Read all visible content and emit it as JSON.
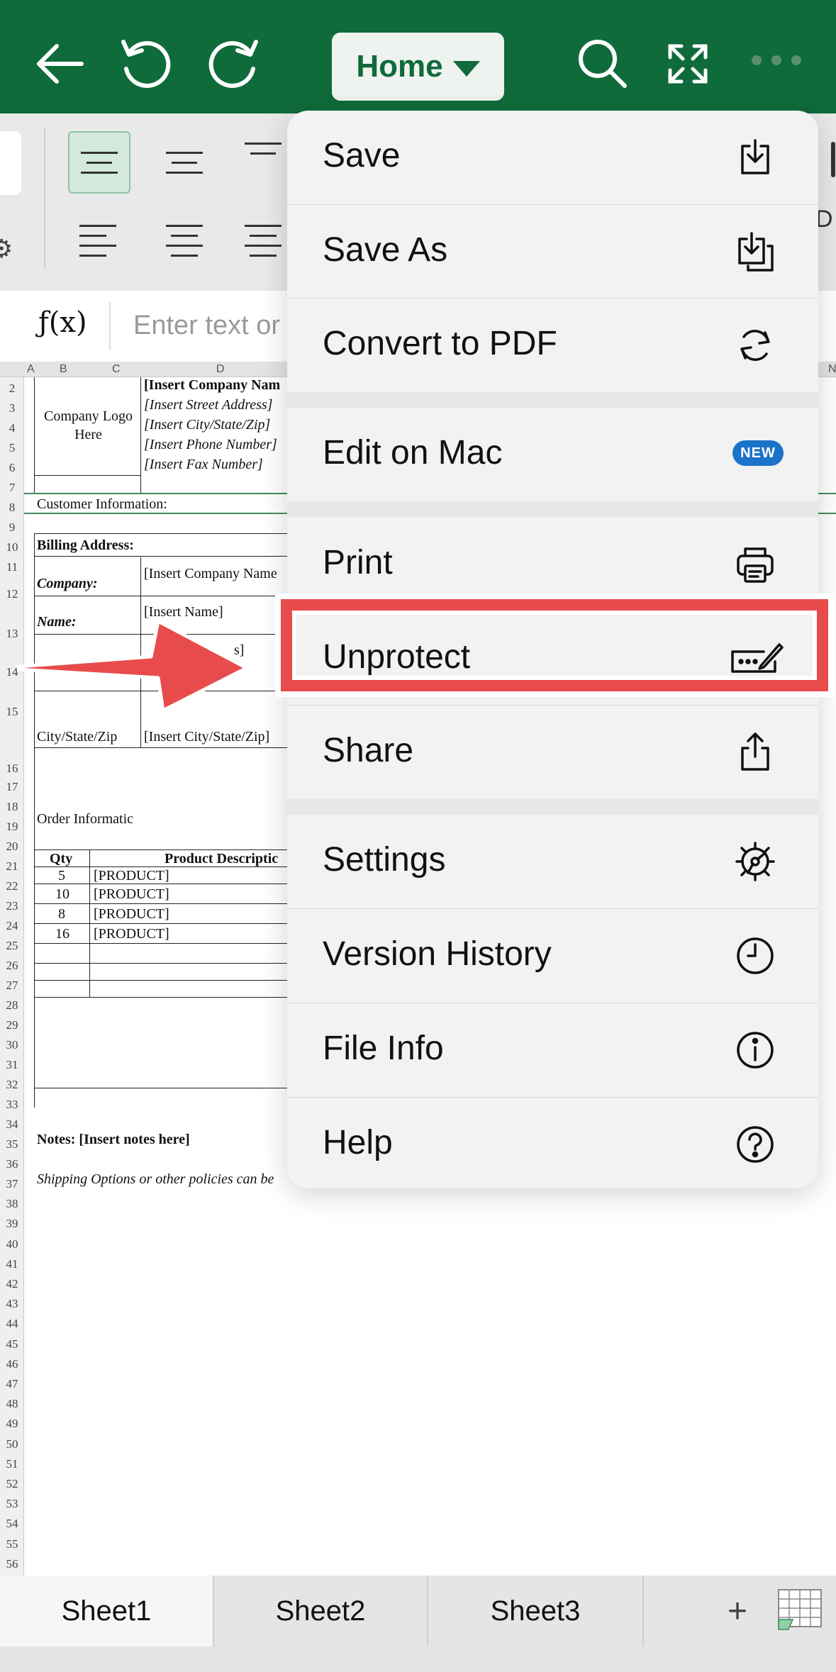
{
  "toolbar": {
    "home_label": "Home",
    "icons": [
      "back-icon",
      "undo-icon",
      "redo-icon",
      "search-icon",
      "fullscreen-icon",
      "more-icon"
    ]
  },
  "ribbon": {
    "partial_letter": "D"
  },
  "formula_bar": {
    "fx_label": "ƒ(x)",
    "placeholder": "Enter text or"
  },
  "sheet": {
    "column_headers": [
      "A",
      "B",
      "C",
      "D",
      "N"
    ],
    "row_numbers": [
      "2",
      "3",
      "4",
      "5",
      "6",
      "7",
      "8",
      "9",
      "10",
      "11",
      "12",
      "13",
      "14",
      "15",
      "16",
      "17",
      "18",
      "19",
      "20",
      "21",
      "22",
      "23",
      "24",
      "25",
      "26",
      "27",
      "28",
      "29",
      "30",
      "31",
      "32",
      "33",
      "34",
      "35",
      "36",
      "37",
      "38",
      "39",
      "40",
      "41",
      "42",
      "43",
      "44",
      "45",
      "46",
      "47",
      "48",
      "49",
      "50",
      "51",
      "52",
      "53",
      "54",
      "55",
      "56"
    ],
    "company_logo": "Company Logo Here",
    "company_lines": [
      "[Insert Company Nam",
      "[Insert Street Address]",
      "[Insert City/State/Zip]",
      "[Insert Phone Number]",
      "[Insert Fax Number]"
    ],
    "customer_info": "Customer Information:",
    "billing_address": "Billing Address:",
    "company_label": "Company:",
    "company_value": "[Insert Company Name",
    "name_label": "Name:",
    "name_value": "[Insert Name]",
    "address_value_fragment": "s]",
    "city_label": "City/State/Zip",
    "city_value": "[Insert City/State/Zip]",
    "order_info": "Order Informatic",
    "qty_header": "Qty",
    "product_header": "Product Descriptic",
    "order_rows": [
      {
        "qty": "5",
        "product": "[PRODUCT]"
      },
      {
        "qty": "10",
        "product": "[PRODUCT]"
      },
      {
        "qty": "8",
        "product": "[PRODUCT]"
      },
      {
        "qty": "16",
        "product": "[PRODUCT]"
      }
    ],
    "notes": "Notes: [Insert notes here]",
    "shipping": "Shipping Options or other policies can be"
  },
  "menu": {
    "items": [
      {
        "label": "Save",
        "icon": "save-icon"
      },
      {
        "label": "Save As",
        "icon": "save-as-icon"
      },
      {
        "label": "Convert to PDF",
        "icon": "convert-icon"
      },
      {
        "label": "Edit on Mac",
        "badge": "NEW"
      },
      {
        "label": "Print",
        "icon": "print-icon"
      },
      {
        "label": "Unprotect",
        "icon": "unprotect-icon"
      },
      {
        "label": "Share",
        "icon": "share-icon"
      },
      {
        "label": "Settings",
        "icon": "settings-icon"
      },
      {
        "label": "Version History",
        "icon": "clock-icon"
      },
      {
        "label": "File Info",
        "icon": "info-icon"
      },
      {
        "label": "Help",
        "icon": "help-icon"
      }
    ]
  },
  "tabs": {
    "sheets": [
      "Sheet1",
      "Sheet2",
      "Sheet3"
    ],
    "add_label": "+"
  },
  "colors": {
    "brand_green": "#0f6b3a",
    "highlight_red": "#e84b4b",
    "badge_blue": "#1a73c8"
  }
}
